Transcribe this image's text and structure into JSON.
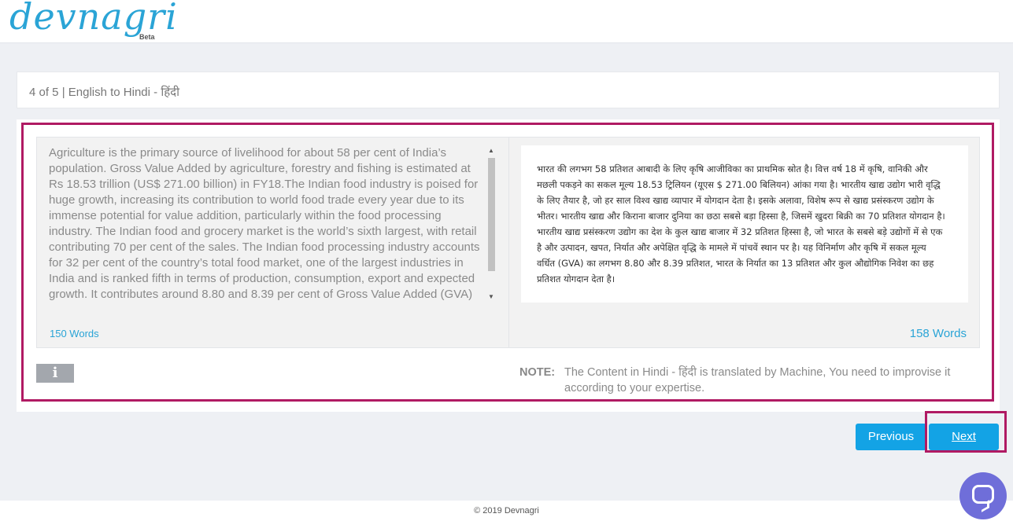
{
  "header": {
    "logo_text": "devnagri",
    "beta_label": "Beta"
  },
  "infobar": {
    "progress_text": "4 of 5 | English to Hindi - हिंदी"
  },
  "source": {
    "text": "Agriculture is the primary source of livelihood for about 58 per cent of India’s population. Gross Value Added by agriculture, forestry and fishing is estimated at Rs 18.53 trillion (US$ 271.00 billion) in FY18.The Indian food industry is poised for huge growth, increasing its contribution to world food trade every year due to its immense potential for value addition, particularly within the food processing industry. The Indian food and grocery market is the world’s sixth largest, with retail contributing 70 per cent of the sales. The Indian food processing industry accounts for 32 per cent of the country’s total food market, one of the largest industries in India and is ranked fifth in terms of production, consumption, export and expected growth. It contributes around 8.80 and 8.39 per cent of Gross Value Added (GVA)",
    "word_count": "150 Words"
  },
  "target": {
    "text": "भारत की लगभग 58 प्रतिशत आबादी के लिए कृषि आजीविका का प्राथमिक स्रोत है। वित्त वर्ष 18 में कृषि, वानिकी और मछली पकड़ने का सकल मूल्य 18.53 ट्रिलियन (यूएस $ 271.00 बिलियन) आंका गया है। भारतीय खाद्य उद्योग भारी वृद्धि के लिए तैयार है, जो हर साल विश्व खाद्य व्यापार में योगदान देता है। इसके अलावा, विशेष रूप से खाद्य प्रसंस्करण उद्योग के भीतर। भारतीय खाद्य और किराना बाजार दुनिया का छठा सबसे बड़ा हिस्सा है, जिसमें खुदरा बिक्री का 70 प्रतिशत योगदान है। भारतीय खाद्य प्रसंस्करण उद्योग का देश के कुल खाद्य बाजार में 32 प्रतिशत हिस्सा है, जो भारत के सबसे बड़े उद्योगों में से एक है और उत्पादन, खपत, निर्यात और अपेक्षित वृद्धि के मामले में पांचवें स्थान पर है। यह विनिर्माण और कृषि में सकल मूल्य वर्धित (GVA) का लगभग 8.80 और 8.39 प्रतिशत, भारत के निर्यात का 13 प्रतिशत और कुल औद्योगिक निवेश का छह प्रतिशत योगदान देता है।",
    "word_count": "158 Words"
  },
  "info": {
    "icon_glyph": "i",
    "icon": "info-icon"
  },
  "note": {
    "label": "NOTE:",
    "text": "The Content in Hindi - हिंदी is translated by Machine, You need to improvise it according to your expertise."
  },
  "buttons": {
    "previous": "Previous",
    "next": "Next"
  },
  "footer": {
    "copyright": "© 2019 Devnagri"
  },
  "chat": {
    "icon": "chat-icon"
  },
  "colors": {
    "accent": "#13a3e5",
    "highlight": "#b01a63",
    "link": "#2aa4d6",
    "chat": "#6f6ed9"
  }
}
